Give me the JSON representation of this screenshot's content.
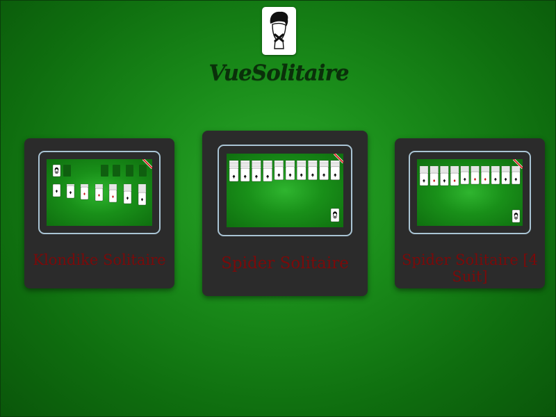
{
  "app": {
    "title": "VueSolitaire",
    "logo_icon": "masked-face-card-icon"
  },
  "games": [
    {
      "name": "Klondike Solitaire",
      "variant": "klondike",
      "has_ribbon": true
    },
    {
      "name": "Spider Solitaire",
      "variant": "spider-1-suit",
      "has_ribbon": true
    },
    {
      "name": "Spider Solitaire [4 Suit]",
      "variant": "spider-4-suit",
      "has_ribbon": true
    }
  ],
  "colors": {
    "felt": "#1a8c1a",
    "card_bg": "#2b2b2b",
    "label": "#7a0a0a",
    "preview_border": "#a9c4d4",
    "title": "#0a300a"
  }
}
